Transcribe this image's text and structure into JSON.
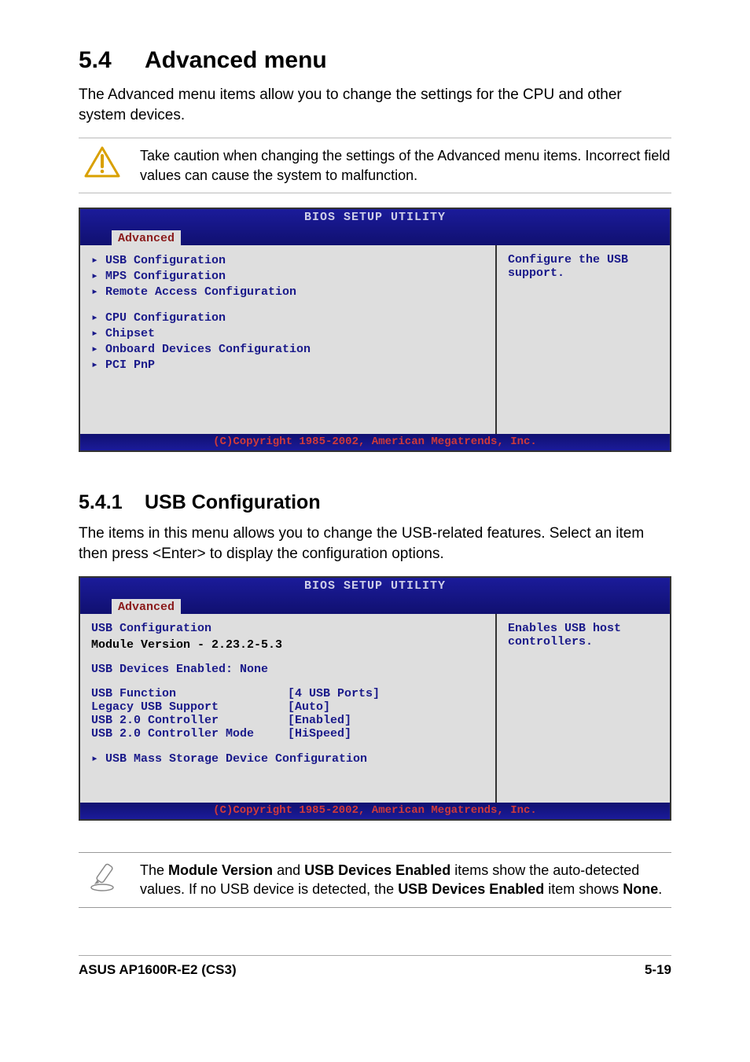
{
  "heading": {
    "number": "5.4",
    "title": "Advanced menu"
  },
  "intro": "The Advanced menu items allow you to change the settings for the CPU and other system devices.",
  "caution": "Take caution when changing the settings of the Advanced menu items. Incorrect field values can cause the system to malfunction.",
  "bios1": {
    "title": "BIOS SETUP UTILITY",
    "tab": "Advanced",
    "items_a": [
      "USB Configuration",
      "MPS Configuration",
      "Remote Access Configuration"
    ],
    "items_b": [
      "CPU Configuration",
      "Chipset",
      "Onboard Devices Configuration",
      "PCI PnP"
    ],
    "help": "Configure the USB support.",
    "copyright": "(C)Copyright 1985-2002, American Megatrends, Inc."
  },
  "sub": {
    "number": "5.4.1",
    "title": "USB Configuration"
  },
  "sub_intro": "The items in this menu allows you to change the USB-related features. Select an item then press <Enter> to display the configuration options.",
  "bios2": {
    "title": "BIOS SETUP UTILITY",
    "tab": "Advanced",
    "section": "USB Configuration",
    "module_version": "Module Version - 2.23.2-5.3",
    "devices_enabled": "USB Devices Enabled: None",
    "rows": [
      {
        "k": "USB Function",
        "v": "[4 USB Ports]"
      },
      {
        "k": "Legacy USB Support",
        "v": "[Auto]"
      },
      {
        "k": "USB 2.0 Controller",
        "v": "[Enabled]"
      },
      {
        "k": "USB 2.0 Controller Mode",
        "v": "[HiSpeed]"
      }
    ],
    "submenu": "USB Mass Storage Device Configuration",
    "help": "Enables USB host controllers.",
    "copyright": "(C)Copyright 1985-2002, American Megatrends, Inc."
  },
  "note": {
    "pre": "The ",
    "b1": "Module Version",
    "mid1": " and ",
    "b2": "USB Devices Enabled",
    "mid2": " items show the auto-detected values. If no USB device is detected, the ",
    "b3": "USB Devices Enabled",
    "mid3": " item shows ",
    "b4": "None",
    "post": "."
  },
  "footer": {
    "left": "ASUS AP1600R-E2 (CS3)",
    "right": "5-19"
  }
}
